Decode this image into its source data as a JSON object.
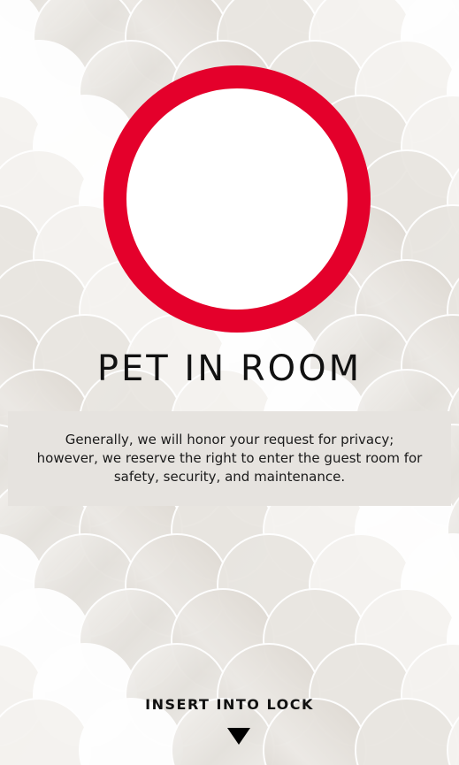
{
  "sign": {
    "title": "PET IN ROOM",
    "notice": "Generally, we will honor your request for privacy; however, we reserve the right to enter the guest room for safety, security, and maintenance.",
    "insert_label": "INSERT INTO LOCK",
    "arrow_icon": "triangle-down-icon"
  },
  "colors": {
    "ring_red": "#e4002b",
    "background_marble": "#eeebe7",
    "notice_band": "#e6e3df",
    "text": "#111111"
  }
}
